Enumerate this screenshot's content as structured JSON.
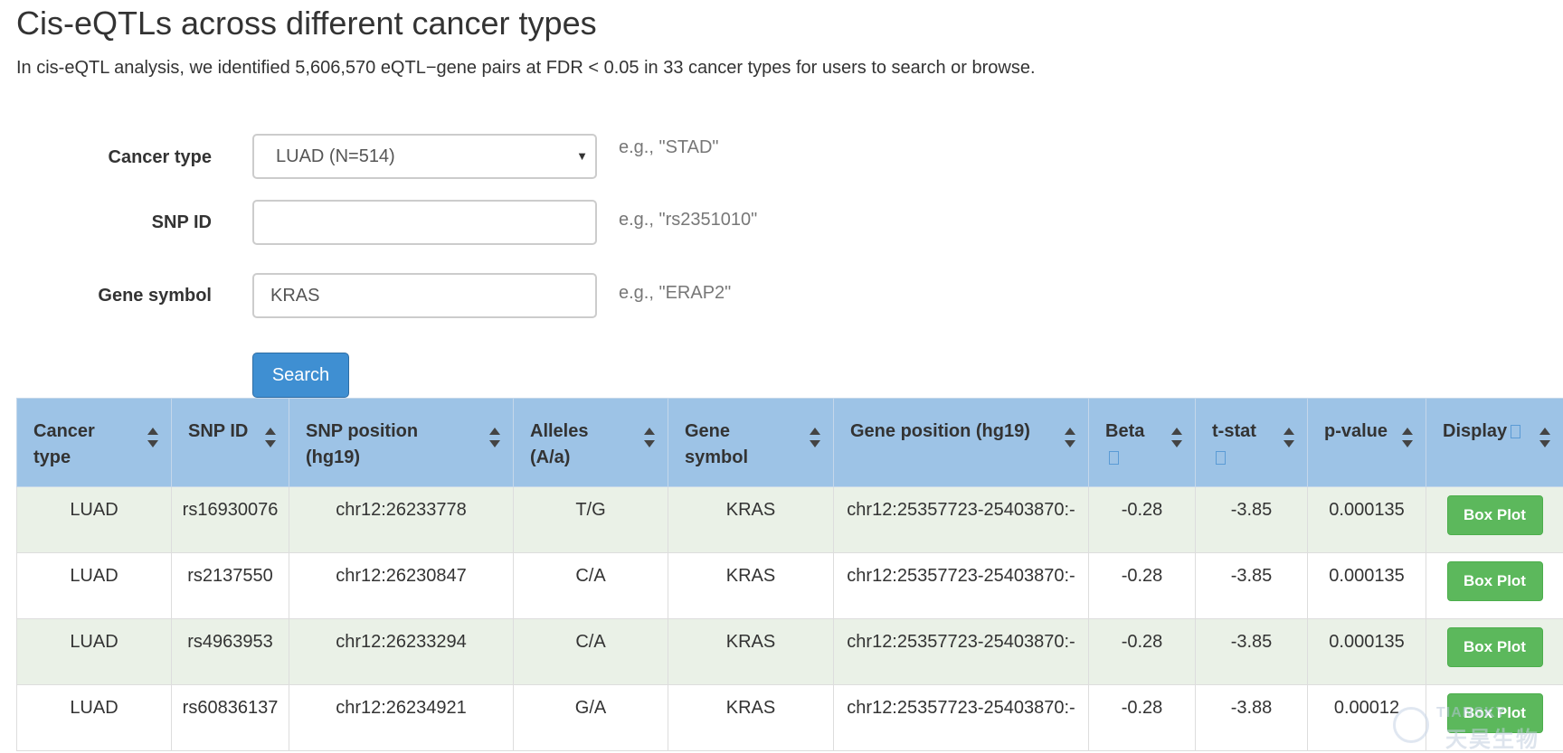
{
  "header": {
    "title": "Cis-eQTLs across different cancer types",
    "intro": "In cis-eQTL analysis, we identified 5,606,570 eQTL−gene pairs at FDR < 0.05 in 33 cancer types for users to search or browse."
  },
  "form": {
    "cancer_type": {
      "label": "Cancer type",
      "value": "LUAD (N=514)",
      "hint": "e.g., \"STAD\""
    },
    "snp_id": {
      "label": "SNP ID",
      "value": "",
      "hint": "e.g., \"rs2351010\""
    },
    "gene_symbol": {
      "label": "Gene symbol",
      "value": "KRAS",
      "hint": "e.g., \"ERAP2\""
    },
    "search_label": "Search"
  },
  "table": {
    "columns": [
      "Cancer type",
      "SNP ID",
      "SNP position (hg19)",
      "Alleles (A/a)",
      "Gene symbol",
      "Gene position (hg19)",
      "Beta",
      "t-stat",
      "p-value",
      "Display"
    ],
    "rows": [
      {
        "cancer_type": "LUAD",
        "snp_id": "rs16930076",
        "snp_position": "chr12:26233778",
        "alleles": "T/G",
        "gene_symbol": "KRAS",
        "gene_position": "chr12:25357723-25403870:-",
        "beta": "-0.28",
        "t_stat": "-3.85",
        "p_value": "0.000135",
        "display": "Box Plot"
      },
      {
        "cancer_type": "LUAD",
        "snp_id": "rs2137550",
        "snp_position": "chr12:26230847",
        "alleles": "C/A",
        "gene_symbol": "KRAS",
        "gene_position": "chr12:25357723-25403870:-",
        "beta": "-0.28",
        "t_stat": "-3.85",
        "p_value": "0.000135",
        "display": "Box Plot"
      },
      {
        "cancer_type": "LUAD",
        "snp_id": "rs4963953",
        "snp_position": "chr12:26233294",
        "alleles": "C/A",
        "gene_symbol": "KRAS",
        "gene_position": "chr12:25357723-25403870:-",
        "beta": "-0.28",
        "t_stat": "-3.85",
        "p_value": "0.000135",
        "display": "Box Plot"
      },
      {
        "cancer_type": "LUAD",
        "snp_id": "rs60836137",
        "snp_position": "chr12:26234921",
        "alleles": "G/A",
        "gene_symbol": "KRAS",
        "gene_position": "chr12:25357723-25403870:-",
        "beta": "-0.28",
        "t_stat": "-3.88",
        "p_value": "0.00012",
        "display": "Box Plot"
      }
    ]
  },
  "watermark": {
    "line1": "TIANSKY",
    "line2": "天昊生物"
  },
  "colors": {
    "header_bg": "#9dc3e6",
    "row_odd": "#eaf1e7",
    "search_button": "#3f8fd2",
    "boxplot_button": "#5cb85c"
  }
}
